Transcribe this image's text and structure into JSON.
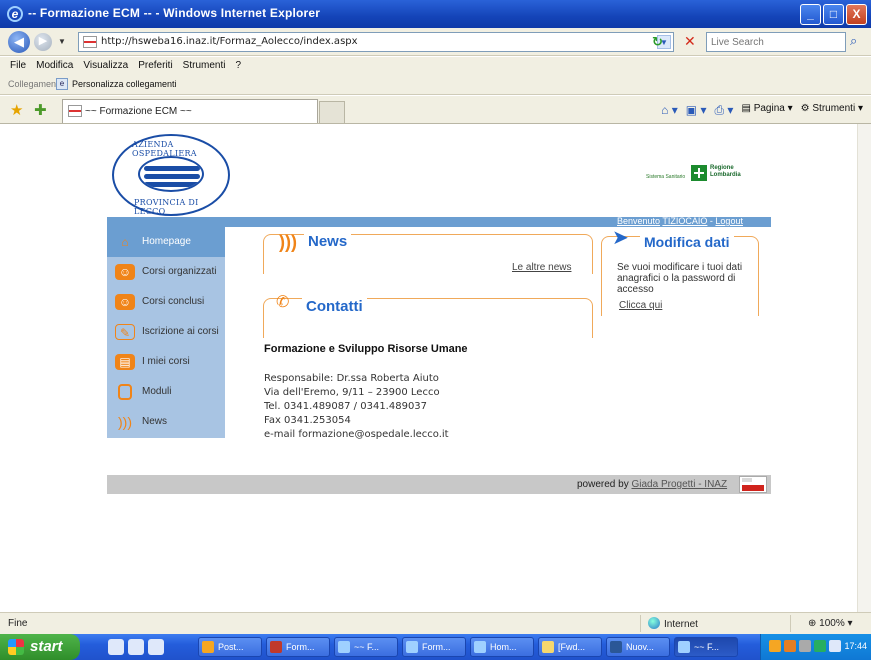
{
  "window": {
    "title": "-- Formazione ECM -- - Windows Internet Explorer",
    "min": "_",
    "max": "□",
    "close": "X"
  },
  "address": {
    "url": "http://hsweba16.inaz.it/Formaz_Aolecco/index.aspx",
    "search_placeholder": "Live Search"
  },
  "menu": [
    "File",
    "Modifica",
    "Visualizza",
    "Preferiti",
    "Strumenti",
    "?"
  ],
  "links": {
    "label": "Collegamenti",
    "item": "Personalizza collegamenti"
  },
  "tab": {
    "label": "~~ Formazione ECM ~~"
  },
  "commands": {
    "page": "Pagina",
    "tools": "Strumenti"
  },
  "page": {
    "seal_top": "AZIENDA OSPEDALIERA",
    "seal_bottom": "PROVINCIA DI LECCO",
    "region_small": "Sistema Sanitario",
    "region_name_1": "Regione",
    "region_name_2": "Lombardia",
    "welcome_prefix": "Benvenuto",
    "welcome_user": "TIZIOCAIO",
    "welcome_sep": "-",
    "logout": "Logout",
    "sidebar": [
      {
        "label": "Homepage",
        "icon": "home-icon",
        "color": "#f08418"
      },
      {
        "label": "Corsi organizzati",
        "icon": "users-icon",
        "color": "#f08418"
      },
      {
        "label": "Corsi conclusi",
        "icon": "users-done-icon",
        "color": "#f08418"
      },
      {
        "label": "Iscrizione ai corsi",
        "icon": "enroll-icon",
        "color": "#f08418"
      },
      {
        "label": "I miei corsi",
        "icon": "my-courses-icon",
        "color": "#f08418"
      },
      {
        "label": "Moduli",
        "icon": "forms-icon",
        "color": "#f08418"
      },
      {
        "label": "News",
        "icon": "rss-icon",
        "color": "#f08418"
      }
    ],
    "news": {
      "title": "News",
      "more": "Le altre news"
    },
    "modifica": {
      "title": "Modifica dati",
      "text": "Se vuoi modificare i tuoi dati anagrafici o la password di accesso",
      "link": "Clicca qui"
    },
    "contatti": {
      "title": "Contatti",
      "heading": "Formazione e Sviluppo Risorse Umane",
      "lines": [
        "Responsabile: Dr.ssa Roberta Aiuto",
        "Via dell'Eremo, 9/11 – 23900 Lecco",
        "Tel. 0341.489087 / 0341.489037",
        "Fax 0341.253054",
        "e-mail formazione@ospedale.lecco.it"
      ]
    },
    "footer": {
      "powered": "powered by",
      "link": "Giada Progetti - INAZ"
    }
  },
  "status": {
    "text": "Fine",
    "zone": "Internet",
    "zoom": "100%"
  },
  "taskbar": {
    "start": "start",
    "buttons": [
      {
        "label": "Post...",
        "color": "#f5a623"
      },
      {
        "label": "Form...",
        "color": "#c0392b"
      },
      {
        "label": "~~ F...",
        "color": "#9fd0ff"
      },
      {
        "label": "Form...",
        "color": "#9fd0ff"
      },
      {
        "label": "Hom...",
        "color": "#9fd0ff"
      },
      {
        "label": "[Fwd...",
        "color": "#f5d76e"
      },
      {
        "label": "Nuov...",
        "color": "#2b5797"
      },
      {
        "label": "~~ F...",
        "color": "#9fd0ff"
      }
    ],
    "clock": "17:44"
  }
}
